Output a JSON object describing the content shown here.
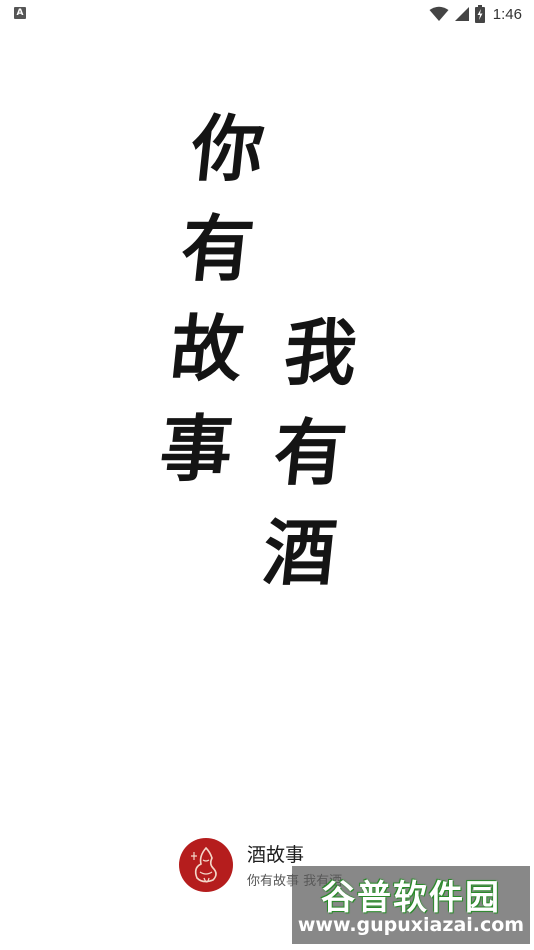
{
  "status_bar": {
    "notification_icon_letter": "A",
    "time": "1:46"
  },
  "splash": {
    "left_column": [
      "你",
      "有",
      "故",
      "事"
    ],
    "right_column": [
      "我",
      "有",
      "酒"
    ]
  },
  "brand": {
    "name": "酒故事",
    "slogan": "你有故事 我有酒"
  },
  "watermark": {
    "title": "谷普软件园",
    "url": "www.gupuxiazai.com"
  },
  "colors": {
    "logo_red": "#b51d1d",
    "ink": "#141414",
    "watermark_green": "#6fd13a"
  }
}
